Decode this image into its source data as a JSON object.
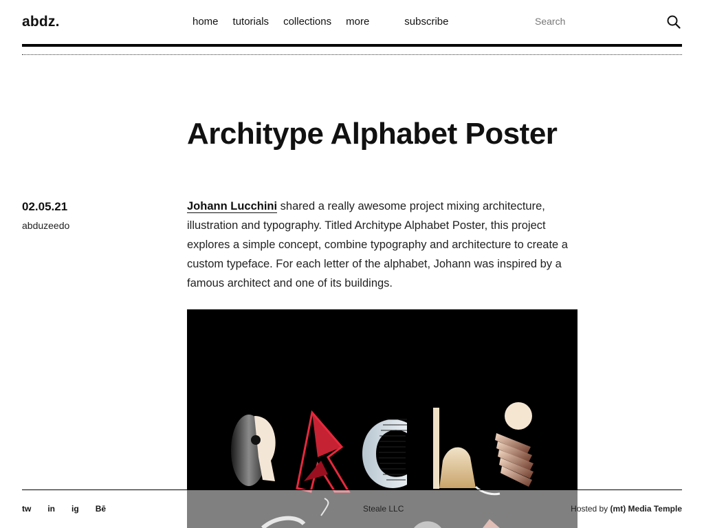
{
  "site": {
    "logo": "abdz."
  },
  "nav": {
    "items": [
      "home",
      "tutorials",
      "collections",
      "more"
    ],
    "subscribe": "subscribe"
  },
  "search": {
    "placeholder": "Search"
  },
  "article": {
    "title": "Architype Alphabet Poster",
    "date": "02.05.21",
    "author": "abduzeedo",
    "author_link": "Johann Lucchini",
    "body": " shared a really awesome project mixing architecture, illustration and typography. Titled Architype Alphabet Poster, this project explores a simple concept, combine typography and architecture to create a custom typeface. For each letter of the alphabet, Johann was inspired by a famous architect and one of its buildings."
  },
  "footer": {
    "social": [
      "tw",
      "in",
      "ig",
      "Bē"
    ],
    "center": "Steale LLC",
    "hosted_prefix": "Hosted by ",
    "hosted_name": "(mt) Media Temple"
  },
  "colors": {
    "poster_bg": "#000000",
    "text": "#111111",
    "accent_red": "#e8283c"
  }
}
